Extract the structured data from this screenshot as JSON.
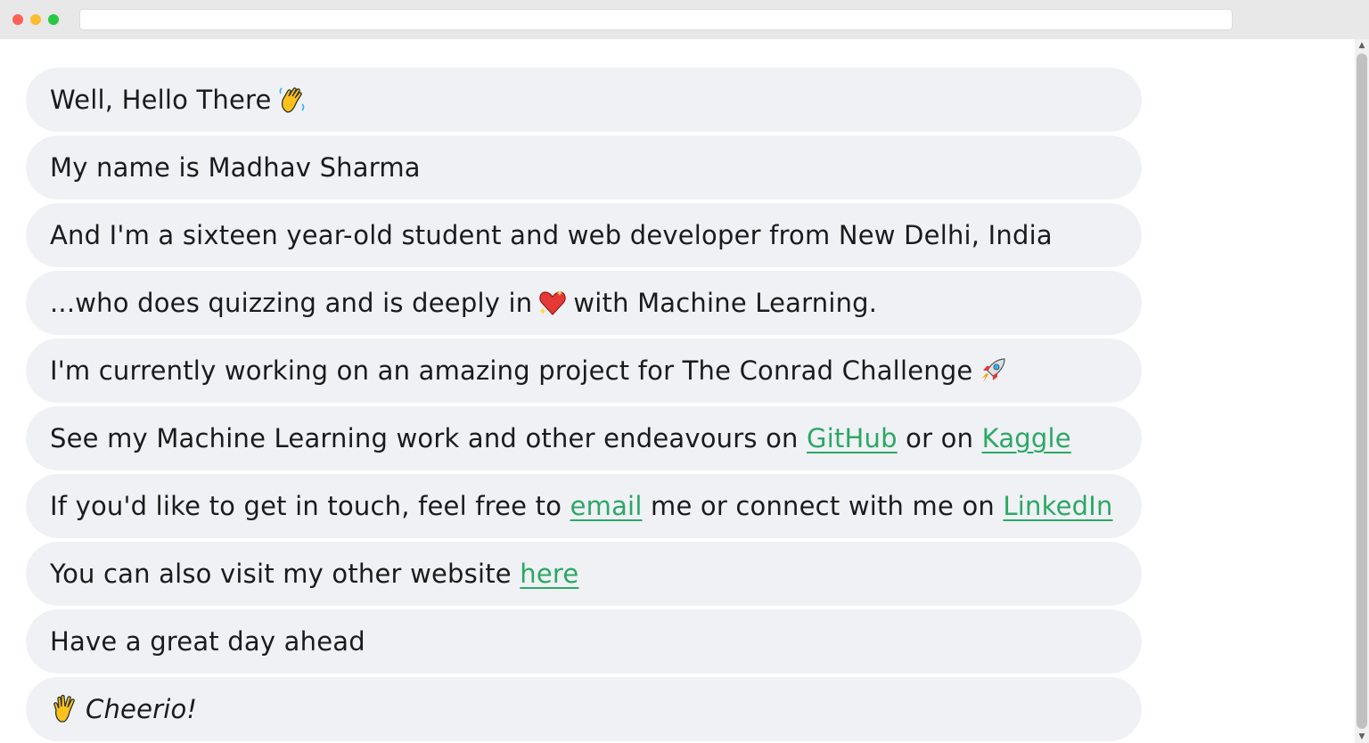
{
  "messages": {
    "m1": {
      "text": "Well, Hello There",
      "icon": "waving-hand-icon"
    },
    "m2": {
      "text": "My name is Madhav Sharma"
    },
    "m3": {
      "text": "And I'm a sixteen year-old student and web developer from New Delhi, India"
    },
    "m4": {
      "before": "...who does quizzing and is deeply in",
      "icon": "sparkling-heart-icon",
      "after": "with Machine Learning."
    },
    "m5": {
      "text": "I'm currently working on an amazing project for The Conrad Challenge",
      "icon": "rocket-icon"
    },
    "m6": {
      "before": "See my Machine Learning work and other endeavours on",
      "link1": "GitHub",
      "middle": "or on",
      "link2": "Kaggle"
    },
    "m7": {
      "before": "If you'd like to get in touch, feel free to",
      "link1": "email",
      "middle": "me or connect with me on",
      "link2": "LinkedIn"
    },
    "m8": {
      "before": "You can also visit my other website",
      "link1": "here"
    },
    "m9": {
      "text": "Have a great day ahead"
    },
    "m10": {
      "icon": "vulcan-salute-icon",
      "text": "Cheerio!"
    }
  },
  "colors": {
    "bubble_background": "#f0f1f5",
    "link": "#2aa865",
    "text": "#1b1b1b"
  }
}
